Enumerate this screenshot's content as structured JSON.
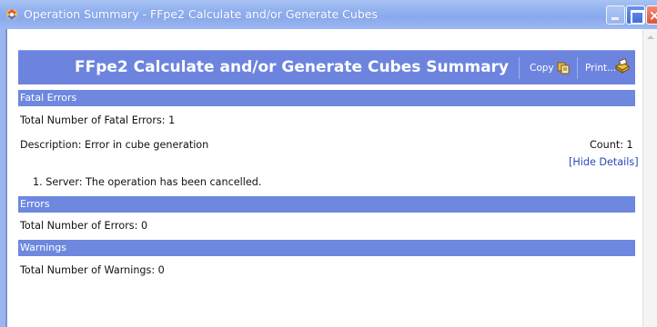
{
  "window": {
    "title": "Operation Summary - FFpe2 Calculate and/or Generate Cubes",
    "icon": "app-icon"
  },
  "banner": {
    "title": "FFpe2 Calculate and/or Generate Cubes Summary",
    "copy_label": "Copy",
    "print_label": "Print..."
  },
  "sections": {
    "fatal_errors": {
      "heading": "Fatal Errors",
      "total_text": "Total Number of Fatal Errors: 1",
      "description": "Description: Error in cube generation",
      "count": "Count: 1",
      "hide_details": "[Hide Details]",
      "detail_items": [
        "1. Server: The operation has been cancelled."
      ]
    },
    "errors": {
      "heading": "Errors",
      "total_text": "Total Number of Errors: 0"
    },
    "warnings": {
      "heading": "Warnings",
      "total_text": "Total Number of Warnings: 0"
    }
  },
  "colors": {
    "banner": "#6d84df",
    "section_bar": "#6e88df",
    "link": "#2a49b8"
  }
}
